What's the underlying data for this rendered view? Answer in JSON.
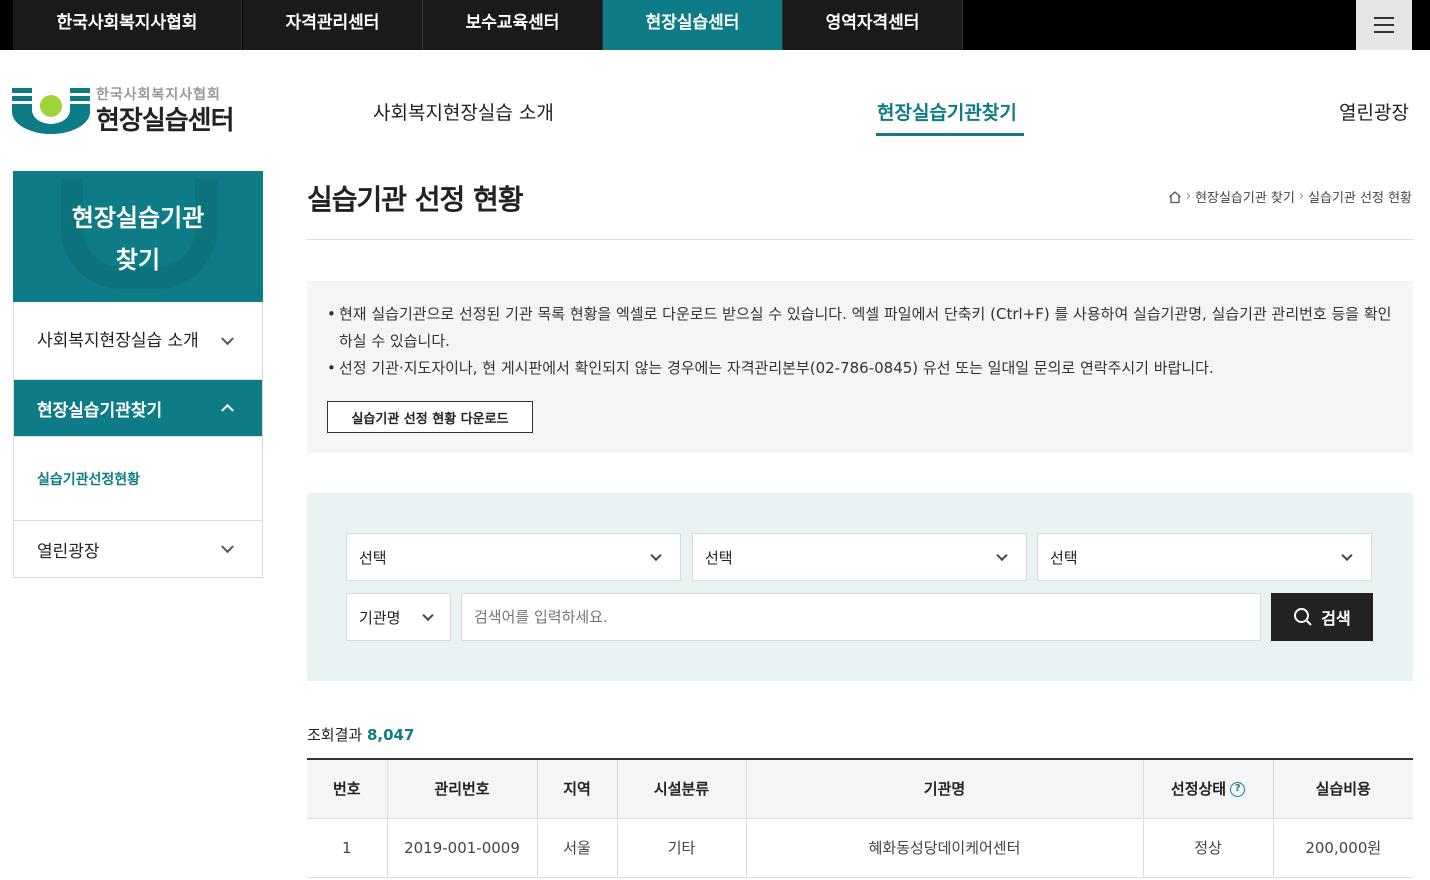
{
  "topbar": {
    "tabs": [
      {
        "label": "한국사회복지사협회"
      },
      {
        "label": "자격관리센터"
      },
      {
        "label": "보수교육센터"
      },
      {
        "label": "현장실습센터"
      },
      {
        "label": "영역자격센터"
      }
    ]
  },
  "header": {
    "logo_sub": "한국사회복지사협회",
    "logo_main": "현장실습센터",
    "nav": [
      {
        "label": "사회복지현장실습 소개"
      },
      {
        "label": "현장실습기관찾기"
      },
      {
        "label": "열린광장"
      }
    ]
  },
  "sidebar": {
    "title_line1": "현장실습기관",
    "title_line2": "찾기",
    "items": [
      {
        "label": "사회복지현장실습 소개"
      },
      {
        "label": "현장실습기관찾기",
        "sub": "실습기관선정현황"
      },
      {
        "label": "열린광장"
      }
    ]
  },
  "page": {
    "title": "실습기관 선정 현황",
    "breadcrumb": [
      "현장실습기관 찾기",
      "실습기관 선정 현황"
    ]
  },
  "notice": {
    "lines": [
      "현재 실습기관으로 선정된 기관 목록 현황을 엑셀로 다운로드 받으실 수 있습니다. 엑셀 파일에서 단축키 (Ctrl+F) 를 사용하여 실습기관명, 실습기관 관리번호 등을 확인하실 수 있습니다.",
      "선정 기관·지도자이나, 현 게시판에서 확인되지 않는 경우에는 자격관리본부(02-786-0845) 유선 또는 일대일 문의로 연락주시기 바랍니다."
    ],
    "download_label": "실습기관 선정 현황 다운로드"
  },
  "search": {
    "select1": "선택",
    "select2": "선택",
    "select3": "선택",
    "field": "기관명",
    "placeholder": "검색어를 입력하세요.",
    "button": "검색"
  },
  "results": {
    "label": "조회결과",
    "count": "8,047",
    "headers": [
      "번호",
      "관리번호",
      "지역",
      "시설분류",
      "기관명",
      "선정상태",
      "실습비용"
    ],
    "rows": [
      [
        "1",
        "2019-001-0009",
        "서울",
        "기타",
        "혜화동성당데이케어센터",
        "정상",
        "200,000원"
      ]
    ]
  },
  "colors": {
    "accent": "#0e7c86",
    "topbar": "#000000",
    "search_bg": "#e9f3f4"
  }
}
